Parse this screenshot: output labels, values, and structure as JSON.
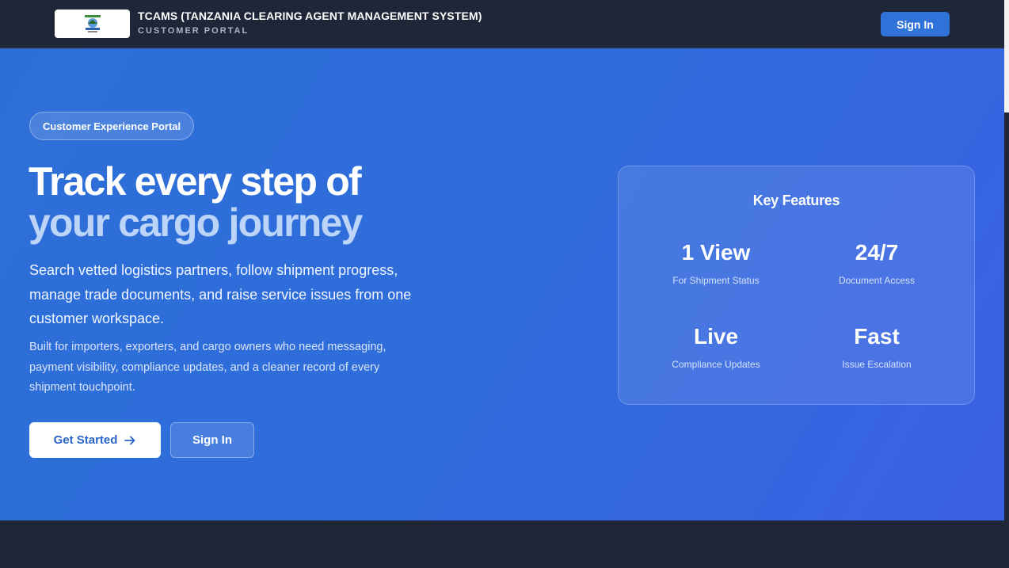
{
  "header": {
    "brand_title": "TCAMS (TANZANIA CLEARING AGENT MANAGEMENT SYSTEM)",
    "brand_subtitle": "CUSTOMER PORTAL",
    "logo_icon": "emblem-logo-icon",
    "signin_label": "Sign In"
  },
  "hero": {
    "pill_label": "Customer Experience Portal",
    "headline_line1": "Track every step of",
    "headline_line2": "your cargo journey",
    "lead": "Search vetted logistics partners, follow shipment progress, manage trade documents, and raise service issues from one customer workspace.",
    "sublead": "Built for importers, exporters, and cargo owners who need messaging, payment visibility, compliance updates, and a cleaner record of every shipment touchpoint.",
    "get_started_label": "Get Started",
    "get_started_icon": "arrow-right-icon",
    "signin_label": "Sign In"
  },
  "features": {
    "title": "Key Features",
    "stats": [
      {
        "value": "1 View",
        "label": "For Shipment Status"
      },
      {
        "value": "24/7",
        "label": "Document Access"
      },
      {
        "value": "Live",
        "label": "Compliance Updates"
      },
      {
        "value": "Fast",
        "label": "Issue Escalation"
      }
    ]
  },
  "colors": {
    "header_bg": "#1e2638",
    "hero_gradient_start": "#2e6fd7",
    "hero_gradient_end": "#3a60e3",
    "primary_button": "#2f73d9",
    "headline_accent": "#bcd4f7"
  }
}
